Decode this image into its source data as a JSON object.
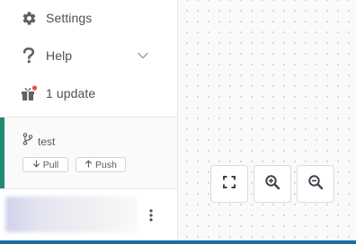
{
  "sidebar": {
    "items": [
      {
        "label": "Settings",
        "icon": "gear-icon"
      },
      {
        "label": "Help",
        "icon": "question-icon",
        "expandable": true
      },
      {
        "label": "1 update",
        "icon": "gift-icon",
        "badge_color": "#ef4b4b"
      }
    ]
  },
  "git": {
    "branch": "test",
    "pull_label": "Pull",
    "push_label": "Push",
    "accent_color": "#1f8a70"
  },
  "user": {
    "menu_icon": "kebab-icon"
  },
  "canvas_controls": {
    "fit_icon": "fit-view-icon",
    "zoom_in_icon": "zoom-in-icon",
    "zoom_out_icon": "zoom-out-icon"
  },
  "colors": {
    "text": "#4b4f58",
    "icon": "#5c6068",
    "bottom_bar": "#1a6fa0"
  }
}
